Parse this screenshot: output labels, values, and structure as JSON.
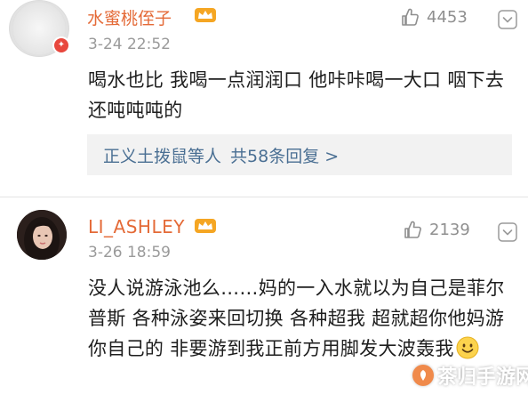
{
  "comments": [
    {
      "username": "水蜜桃侄子",
      "time": "3-24 22:52",
      "likes": "4453",
      "text": "喝水也比 我喝一点润润口 他咔咔喝一大口 咽下去还吨吨吨的",
      "reply_summary": {
        "names": "正义土拨鼠等人",
        "count_text": "共58条回复 >"
      }
    },
    {
      "username": "LI_ASHLEY",
      "time": "3-26 18:59",
      "likes": "2139",
      "text": "没人说游泳池么……妈的一入水就以为自己是菲尔普斯 各种泳姿来回切换 各种超我 超就超你他妈游你自己的 非要游到我正前方用脚发大波轰我"
    }
  ],
  "watermark": "茶归手游网",
  "colors": {
    "username": "#e46a37",
    "reply_link": "#4a6f93",
    "badge": "#e8473d",
    "time": "#9a9a9a"
  },
  "icons": [
    "vip-crown-icon",
    "like-thumb-icon",
    "chevron-down-icon",
    "smile-emoji-icon",
    "verified-badge-icon"
  ]
}
